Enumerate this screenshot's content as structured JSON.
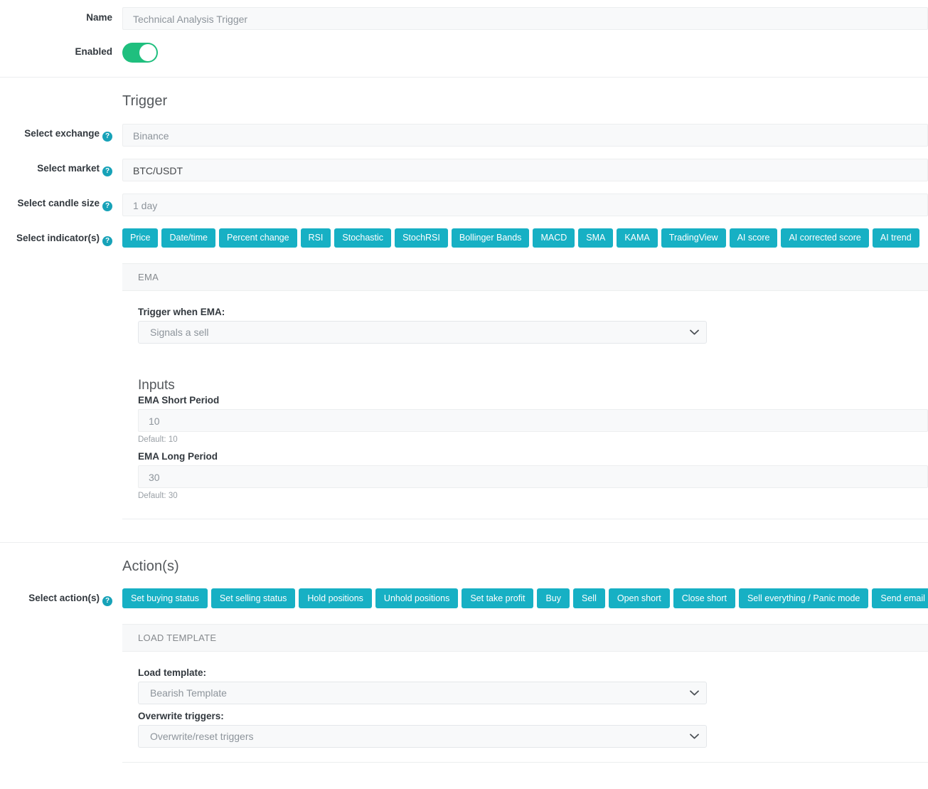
{
  "form": {
    "name": {
      "label": "Name",
      "value": "Technical Analysis Trigger"
    },
    "enabled": {
      "label": "Enabled",
      "state": "on"
    }
  },
  "trigger": {
    "title": "Trigger",
    "exchange": {
      "label": "Select exchange",
      "value": "Binance",
      "help": "?"
    },
    "market": {
      "label": "Select market",
      "value": "BTC/USDT",
      "help": "?"
    },
    "candle": {
      "label": "Select candle size",
      "value": "1 day",
      "help": "?"
    },
    "indicators": {
      "label": "Select indicator(s)",
      "help": "?",
      "options": [
        "Price",
        "Date/time",
        "Percent change",
        "RSI",
        "Stochastic",
        "StochRSI",
        "Bollinger Bands",
        "MACD",
        "SMA",
        "KAMA",
        "TradingView",
        "AI score",
        "AI corrected score",
        "AI trend"
      ]
    },
    "panel": {
      "header": "EMA",
      "trigger_when_label": "Trigger when EMA:",
      "trigger_when_value": "Signals a sell",
      "inputs_title": "Inputs",
      "fields": [
        {
          "label": "EMA Short Period",
          "value": "10",
          "default_text": "Default: 10"
        },
        {
          "label": "EMA Long Period",
          "value": "30",
          "default_text": "Default: 30"
        }
      ]
    }
  },
  "actions": {
    "title": "Action(s)",
    "select": {
      "label": "Select action(s)",
      "help": "?",
      "options": [
        "Set buying status",
        "Set selling status",
        "Hold positions",
        "Unhold positions",
        "Set take profit",
        "Buy",
        "Sell",
        "Open short",
        "Close short",
        "Sell everything / Panic mode",
        "Send email"
      ]
    },
    "panel": {
      "header": "LOAD TEMPLATE",
      "load_label": "Load template:",
      "load_value": "Bearish Template",
      "overwrite_label": "Overwrite triggers:",
      "overwrite_value": "Overwrite/reset triggers"
    }
  },
  "colors": {
    "accent_teal": "#17b0c4",
    "help_teal": "#17a2b8",
    "toggle_green": "#1fbf7e",
    "input_bg": "#f8f9fa",
    "border": "#eceeef"
  }
}
